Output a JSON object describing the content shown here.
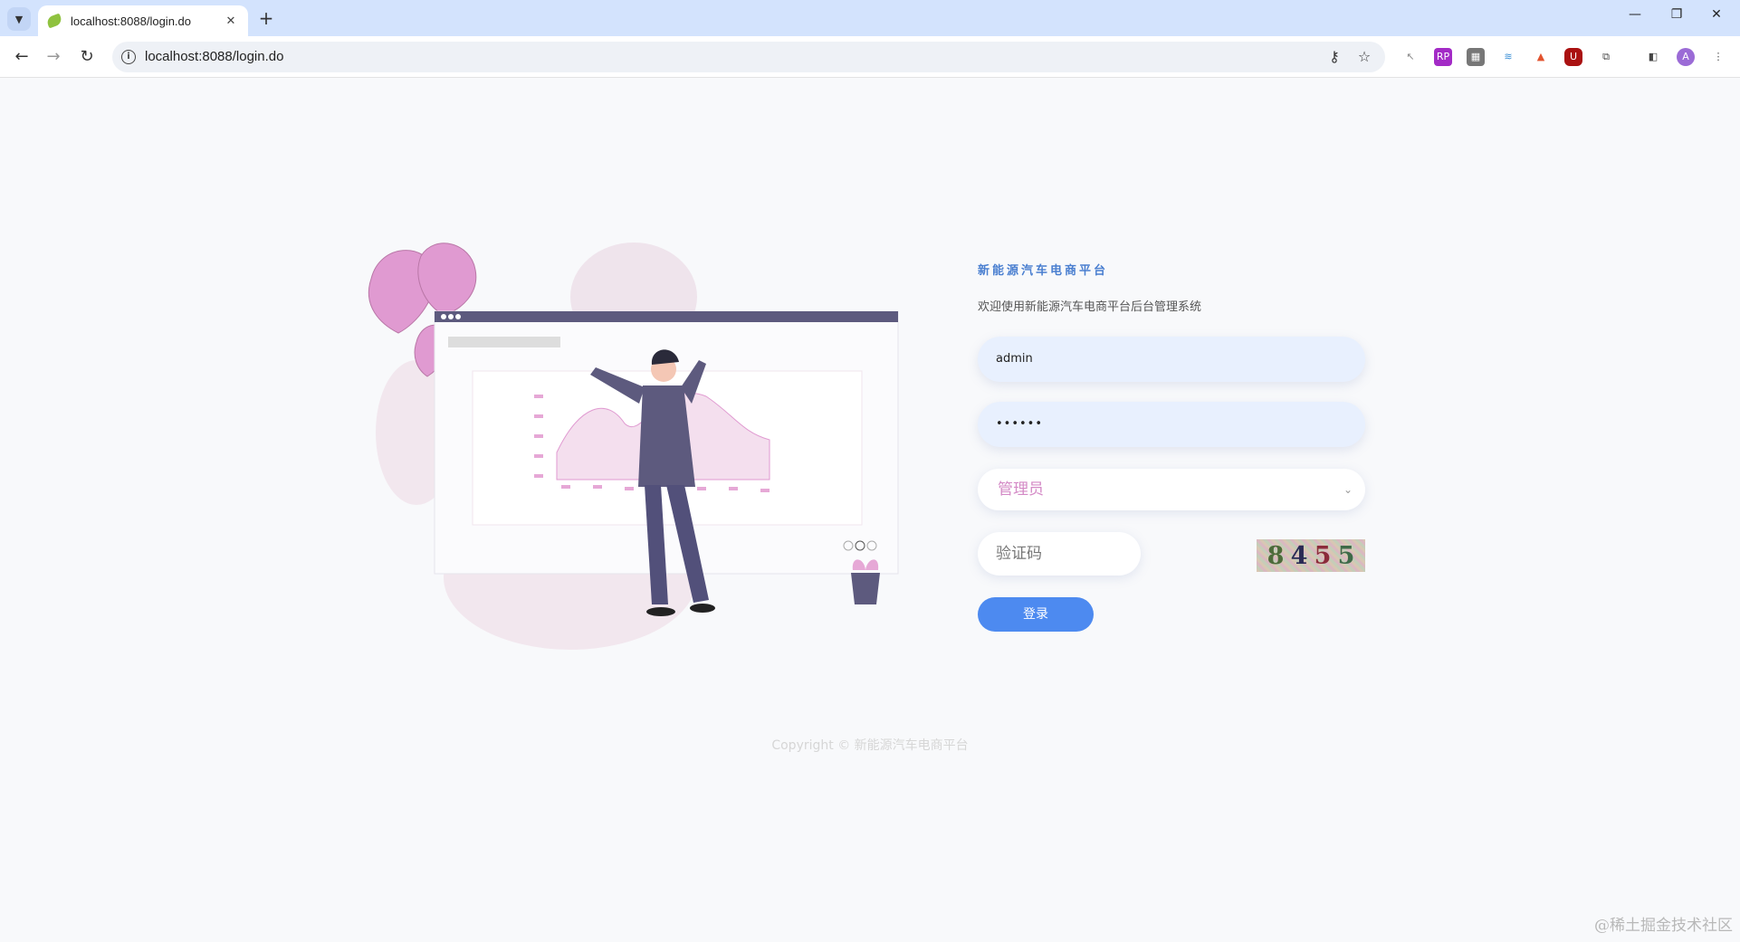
{
  "browser": {
    "tab_title": "localhost:8088/login.do",
    "url": "localhost:8088/login.do",
    "new_tab_label": "+",
    "close_tab_label": "✕",
    "window_controls": [
      "—",
      "❐",
      "✕"
    ]
  },
  "login": {
    "brand_title": "新能源汽车电商平台",
    "welcome_text": "欢迎使用新能源汽车电商平台后台管理系统",
    "username_value": "admin",
    "password_value": "••••••",
    "role_selected": "管理员",
    "captcha_placeholder": "验证码",
    "captcha_digits": [
      "8",
      "4",
      "5",
      "5"
    ],
    "captcha_colors": [
      "#4d6b3a",
      "#2a2a55",
      "#8b2b3a",
      "#3e6a48"
    ],
    "login_button": "登录"
  },
  "footer": {
    "copyright": "Copyright © 新能源汽车电商平台"
  },
  "watermark": "@稀土掘金技术社区",
  "colors": {
    "accent": "#4d8af0",
    "title": "#4a7fd0",
    "input_bg": "#e8f0fe",
    "role_text": "#d48ac6",
    "illustration_pink": "#e09ad1",
    "illustration_purple": "#5d5a7e"
  }
}
